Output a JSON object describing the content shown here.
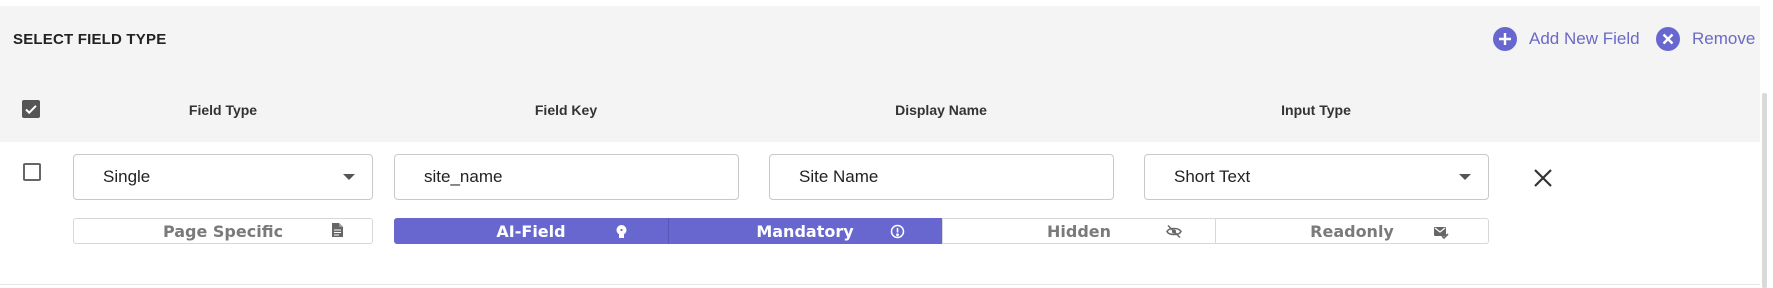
{
  "header": {
    "title": "SELECT FIELD TYPE",
    "add_label": "Add New Field",
    "remove_label": "Remove"
  },
  "columns": [
    "Field Type",
    "Field Key",
    "Display Name",
    "Input Type"
  ],
  "row": {
    "checked": false,
    "field_type": "Single",
    "field_key": "site_name",
    "display_name": "Site Name",
    "input_type": "Short Text",
    "page_specific_label": "Page Specific",
    "options": [
      {
        "label": "AI-Field",
        "active": true,
        "icon": "lightbulb-icon"
      },
      {
        "label": "Mandatory",
        "active": true,
        "icon": "alert-circle-icon"
      },
      {
        "label": "Hidden",
        "active": false,
        "icon": "eye-off-icon"
      },
      {
        "label": "Readonly",
        "active": false,
        "icon": "readonly-icon"
      }
    ]
  },
  "select_all_checked": true,
  "colors": {
    "accent": "#6867d0",
    "header_bg": "#f4f4f4"
  }
}
